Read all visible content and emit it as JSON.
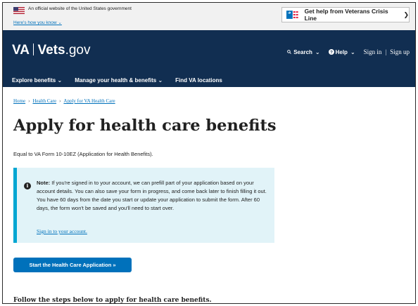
{
  "banner": {
    "official_text": "An official website of the United States government",
    "how_link": "Here's how you know",
    "crisis_line": "Get help from Veterans Crisis Line"
  },
  "header": {
    "logo_va": "VA",
    "logo_vets": "Vets",
    "logo_gov": ".gov",
    "search_label": "Search",
    "help_label": "Help",
    "sign_in": "Sign in",
    "sign_up": "Sign up",
    "sign_separator": "|"
  },
  "nav": {
    "items": [
      {
        "label": "Explore benefits"
      },
      {
        "label": "Manage your health & benefits"
      },
      {
        "label": "Find VA locations"
      }
    ]
  },
  "breadcrumb": {
    "items": [
      "Home",
      "Health Care",
      "Apply for VA Health Care"
    ],
    "separator": "›"
  },
  "main": {
    "title": "Apply for health care benefits",
    "subtitle": "Equal to VA Form 10-10EZ (Application for Health Benefits).",
    "alert": {
      "note_label": "Note:",
      "text": "If you're signed in to your account, we can prefill part of your application based on your account details. You can also save your form in progress, and come back later to finish filling it out. You have 60 days from the date you start or update your application to submit the form. After 60 days, the form won't be saved and you'll need to start over.",
      "link": "Sign in to your account."
    },
    "start_button": "Start the Health Care Application »",
    "follow_heading": "Follow the steps below to apply for health care benefits."
  },
  "colors": {
    "header_bg": "#112e51",
    "link": "#0071bb",
    "alert_bg": "#e1f3f8",
    "alert_border": "#00a6d2",
    "button_bg": "#0071bb"
  }
}
